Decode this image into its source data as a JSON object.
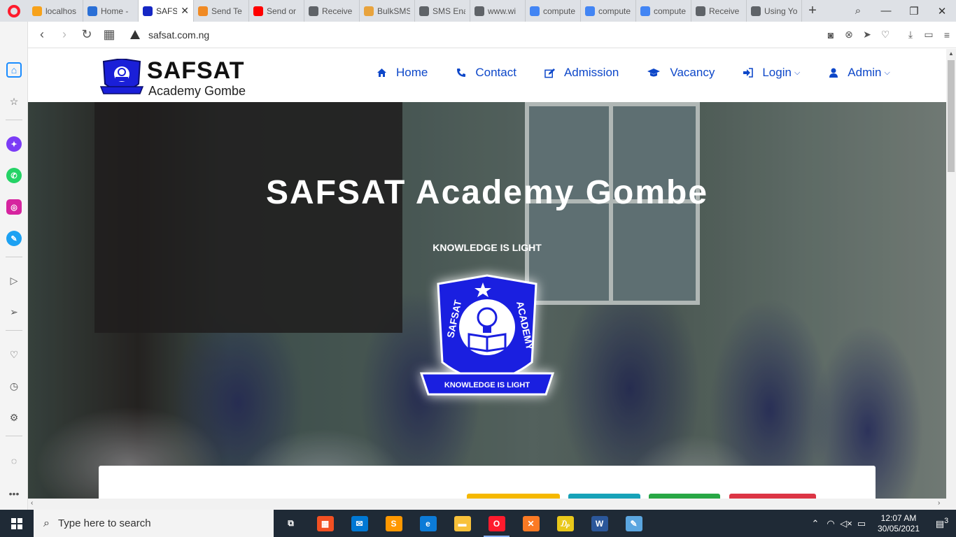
{
  "browser": {
    "tabs": [
      {
        "label": "localhos",
        "icon": "phpmyadmin-icon",
        "color": "#f7a21b",
        "active": false
      },
      {
        "label": "Home -",
        "icon": "home-page-icon",
        "color": "#2a6fd6",
        "active": false
      },
      {
        "label": "SAFS",
        "icon": "safsat-icon",
        "color": "#1627c4",
        "active": true
      },
      {
        "label": "Send Te",
        "icon": "chat-icon",
        "color": "#f08a24",
        "active": false
      },
      {
        "label": "Send or",
        "icon": "youtube-icon",
        "color": "#ff0000",
        "active": false
      },
      {
        "label": "Receive",
        "icon": "document-icon",
        "color": "#5f6368",
        "active": false
      },
      {
        "label": "BulkSMS",
        "icon": "mail-icon",
        "color": "#e8a33d",
        "active": false
      },
      {
        "label": "SMS Ena",
        "icon": "document-icon",
        "color": "#5f6368",
        "active": false
      },
      {
        "label": "www.wi",
        "icon": "document-icon",
        "color": "#5f6368",
        "active": false
      },
      {
        "label": "compute",
        "icon": "google-icon",
        "color": "#4285f4",
        "active": false
      },
      {
        "label": "compute",
        "icon": "google-icon",
        "color": "#4285f4",
        "active": false
      },
      {
        "label": "compute",
        "icon": "google-icon",
        "color": "#4285f4",
        "active": false
      },
      {
        "label": "Receive",
        "icon": "document-icon",
        "color": "#5f6368",
        "active": false
      },
      {
        "label": "Using Yo",
        "icon": "document-icon",
        "color": "#5f6368",
        "active": false
      }
    ],
    "url": "safsat.com.ng"
  },
  "site": {
    "brand_title": "SAFSAT",
    "brand_subtitle": "Academy Gombe",
    "nav": [
      {
        "label": "Home",
        "icon": "home-icon"
      },
      {
        "label": "Contact",
        "icon": "phone-icon"
      },
      {
        "label": "Admission",
        "icon": "edit-icon"
      },
      {
        "label": "Vacancy",
        "icon": "graduation-cap-icon"
      },
      {
        "label": "Login",
        "icon": "sign-in-icon",
        "dropdown": true
      },
      {
        "label": "Admin",
        "icon": "user-icon",
        "dropdown": true
      }
    ],
    "nav_color": "#0d47c9",
    "hero": {
      "title": "SAFSAT Academy Gombe",
      "motto": "KNOWLEDGE IS LIGHT",
      "badge_text_left": "SAFSAT",
      "badge_text_right": "ACADEMY",
      "badge_ribbon": "KNOWLEDGE IS LIGHT"
    },
    "card_buttons": [
      {
        "color": "#f5b800"
      },
      {
        "color": "#17a2b8"
      },
      {
        "color": "#28a745"
      },
      {
        "color": "#dc3545"
      }
    ]
  },
  "taskbar": {
    "search_placeholder": "Type here to search",
    "time": "12:07 AM",
    "date": "30/05/2021",
    "notifications": "3",
    "apps": [
      {
        "name": "task-view",
        "color": "#1f2a36",
        "glyph": "⧉"
      },
      {
        "name": "microsoft-store",
        "color": "#f25022",
        "glyph": "▦"
      },
      {
        "name": "mail",
        "color": "#0078d4",
        "glyph": "✉"
      },
      {
        "name": "sublime-text",
        "color": "#ff9800",
        "glyph": "S"
      },
      {
        "name": "edge",
        "color": "#0c7bd7",
        "glyph": "e"
      },
      {
        "name": "file-explorer",
        "color": "#f8c13a",
        "glyph": "▬"
      },
      {
        "name": "opera",
        "color": "#ff1b2d",
        "glyph": "O"
      },
      {
        "name": "xampp",
        "color": "#fb7a24",
        "glyph": "✕"
      },
      {
        "name": "app-yellow",
        "color": "#e9c81a",
        "glyph": "₯"
      },
      {
        "name": "word",
        "color": "#2b579a",
        "glyph": "W"
      },
      {
        "name": "paint",
        "color": "#5ba6e0",
        "glyph": "✎"
      }
    ]
  }
}
